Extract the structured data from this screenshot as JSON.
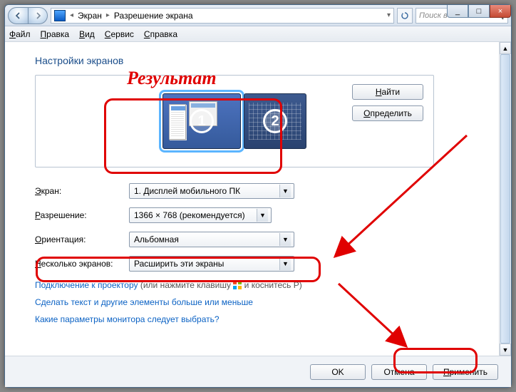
{
  "titlebar": {
    "crumb1": "Экран",
    "crumb2": "Разрешение экрана",
    "search_placeholder": "Поиск в панели ..."
  },
  "window_controls": {
    "min_label": "_",
    "max_label": "□",
    "close_label": "×"
  },
  "menubar": {
    "file": "Файл",
    "edit": "Правка",
    "view": "Вид",
    "tools": "Сервис",
    "help": "Справка"
  },
  "page": {
    "heading": "Настройки экранов",
    "find_btn": "Найти",
    "detect_btn": "Определить",
    "monitor1_num": "1",
    "monitor2_num": "2"
  },
  "form": {
    "display_label": "Экран:",
    "display_value": "1. Дисплей мобильного ПК",
    "resolution_label": "Разрешение:",
    "resolution_value": "1366 × 768 (рекомендуется)",
    "orientation_label": "Ориентация:",
    "orientation_value": "Альбомная",
    "multi_label": "Несколько экранов:",
    "multi_value": "Расширить эти экраны"
  },
  "links": {
    "projector_link": "Подключение к проектору",
    "projector_rest": " (или нажмите клавишу ",
    "projector_end": " и коснитесь P)",
    "textsize": "Сделать текст и другие элементы больше или меньше",
    "whichmon": "Какие параметры монитора следует выбрать?"
  },
  "dialog": {
    "ok": "OK",
    "cancel": "Отмена",
    "apply": "Применить"
  },
  "annotation": {
    "result_label": "Результат"
  }
}
